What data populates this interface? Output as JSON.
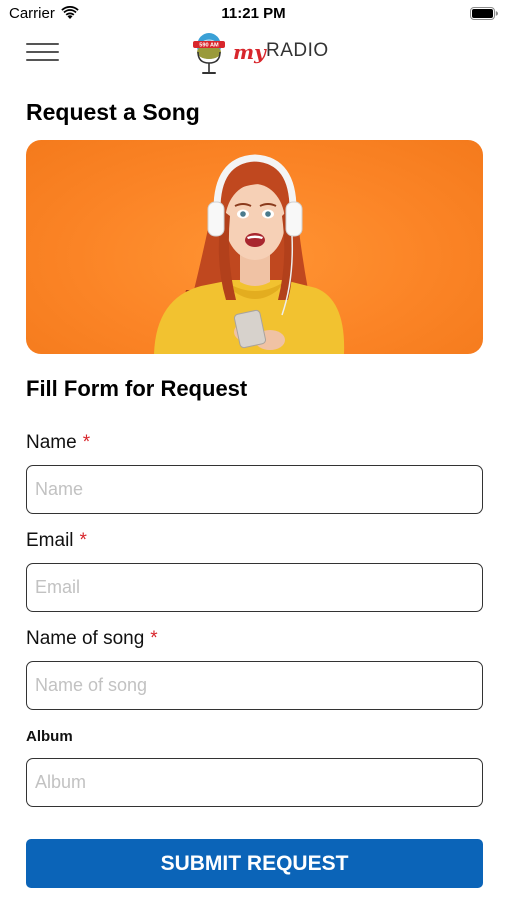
{
  "status_bar": {
    "carrier": "Carrier",
    "time": "11:21 PM",
    "icons": [
      "wifi-icon",
      "battery-icon"
    ]
  },
  "header": {
    "menu_icon": "hamburger-menu-icon",
    "logo": {
      "badge": "590 AM",
      "brand_my": "my",
      "brand_radio": "RADIO"
    }
  },
  "page": {
    "title": "Request a Song",
    "hero_image": "girl-with-headphones-photo"
  },
  "form": {
    "title": "Fill Form for Request",
    "required_mark": "*",
    "fields": [
      {
        "label": "Name",
        "required": true,
        "placeholder": "Name",
        "value": ""
      },
      {
        "label": "Email",
        "required": true,
        "placeholder": "Email",
        "value": ""
      },
      {
        "label": "Name of song",
        "required": true,
        "placeholder": "Name of song",
        "value": ""
      },
      {
        "label": "Album",
        "required": false,
        "placeholder": "Album",
        "value": ""
      }
    ],
    "submit_label": "SUBMIT REQUEST"
  },
  "colors": {
    "accent": "#0b64b8",
    "required": "#d8262c",
    "hero_bg": "#fb8426"
  }
}
